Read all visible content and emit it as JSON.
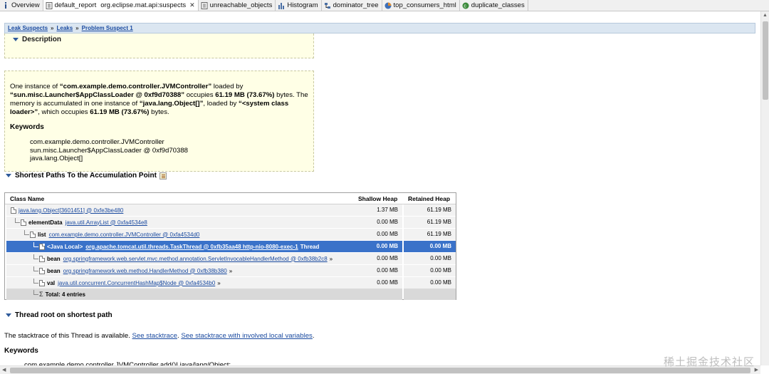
{
  "tabs": [
    {
      "label": "Overview",
      "icon": "info-icon"
    },
    {
      "label": "default_report",
      "sub": "org.eclipse.mat.api:suspects",
      "icon": "report-icon",
      "active": true,
      "closable": true
    },
    {
      "label": "unreachable_objects",
      "icon": "report-icon"
    },
    {
      "label": "Histogram",
      "icon": "histogram-icon"
    },
    {
      "label": "dominator_tree",
      "icon": "tree-icon"
    },
    {
      "label": "top_consumers_html",
      "icon": "pie-icon"
    },
    {
      "label": "duplicate_classes",
      "icon": "duplicate-icon"
    }
  ],
  "breadcrumb": {
    "items": [
      "Leak Suspects",
      "Leaks",
      "Problem Suspect 1"
    ],
    "separator": "»"
  },
  "description": {
    "title": "Description",
    "text_1": "One instance of ",
    "b_1": "“com.example.demo.controller.JVMController”",
    "text_2": " loaded by ",
    "b_2": "“sun.misc.Launcher$AppClassLoader @ 0xf9d70388”",
    "text_3": " occupies ",
    "b_3": "61.19 MB (73.67%)",
    "text_4": " bytes. The memory is accumulated in one instance of ",
    "b_4": "“java.lang.Object[]”",
    "text_5": ", loaded by ",
    "b_5": "“<system class loader>”",
    "text_6": ", which occupies ",
    "b_6": "61.19 MB (73.67%)",
    "text_7": " bytes.",
    "keywords_title": "Keywords",
    "keywords": [
      "com.example.demo.controller.JVMController",
      "sun.misc.Launcher$AppClassLoader @ 0xf9d70388",
      "java.lang.Object[]"
    ]
  },
  "shortest_paths": {
    "title": "Shortest Paths To the Accumulation Point",
    "columns": {
      "class_name": "Class Name",
      "shallow": "Shallow Heap",
      "retained": "Retained Heap"
    },
    "rows": [
      {
        "field": "",
        "link": "java.lang.Object[3601451] @ 0xfe3be480",
        "suffix": "",
        "shallow": "1.37 MB",
        "retained": "61.19 MB"
      },
      {
        "field": "elementData",
        "link": "java.util.ArrayList @ 0xfa4534e8",
        "suffix": "",
        "shallow": "0.00 MB",
        "retained": "61.19 MB"
      },
      {
        "field": "list",
        "link": "com.example.demo.controller.JVMController @ 0xfa4534d0",
        "suffix": "",
        "shallow": "0.00 MB",
        "retained": "61.19 MB"
      },
      {
        "field": "<Java Local>",
        "link": "org.apache.tomcat.util.threads.TaskThread @ 0xfb35aa48 http-nio-8080-exec-1",
        "suffix": "Thread",
        "shallow": "0.00 MB",
        "retained": "0.00 MB"
      },
      {
        "field": "bean",
        "link": "org.springframework.web.servlet.mvc.method.annotation.ServletInvocableHandlerMethod @ 0xfb38b2c8",
        "suffix": "»",
        "shallow": "0.00 MB",
        "retained": "0.00 MB"
      },
      {
        "field": "bean",
        "link": "org.springframework.web.method.HandlerMethod @ 0xfb38b380",
        "suffix": "»",
        "shallow": "0.00 MB",
        "retained": "0.00 MB"
      },
      {
        "field": "val",
        "link": "java.util.concurrent.ConcurrentHashMap$Node @ 0xfa4534b0",
        "suffix": "»",
        "shallow": "0.00 MB",
        "retained": "0.00 MB"
      },
      {
        "field": "Total: 4 entries",
        "link": "",
        "suffix": "",
        "shallow": "",
        "retained": ""
      }
    ]
  },
  "thread_root": {
    "title": "Thread root on shortest path",
    "text": "The stacktrace of this Thread is available. ",
    "link_1": "See stacktrace",
    "sep": ". ",
    "link_2": "See stacktrace with involved local variables",
    "end": ".",
    "keywords_title": "Keywords",
    "keyword_partial": "com.example.demo.controller.JVMController.add()Ljava/lang/Object;"
  },
  "watermark": "稀土掘金技术社区",
  "colors": {
    "accent": "#3a72c9",
    "link": "#1b4ba0",
    "note_bg": "#ffffe6",
    "breadcrumb_bg": "#dbe6f1"
  }
}
